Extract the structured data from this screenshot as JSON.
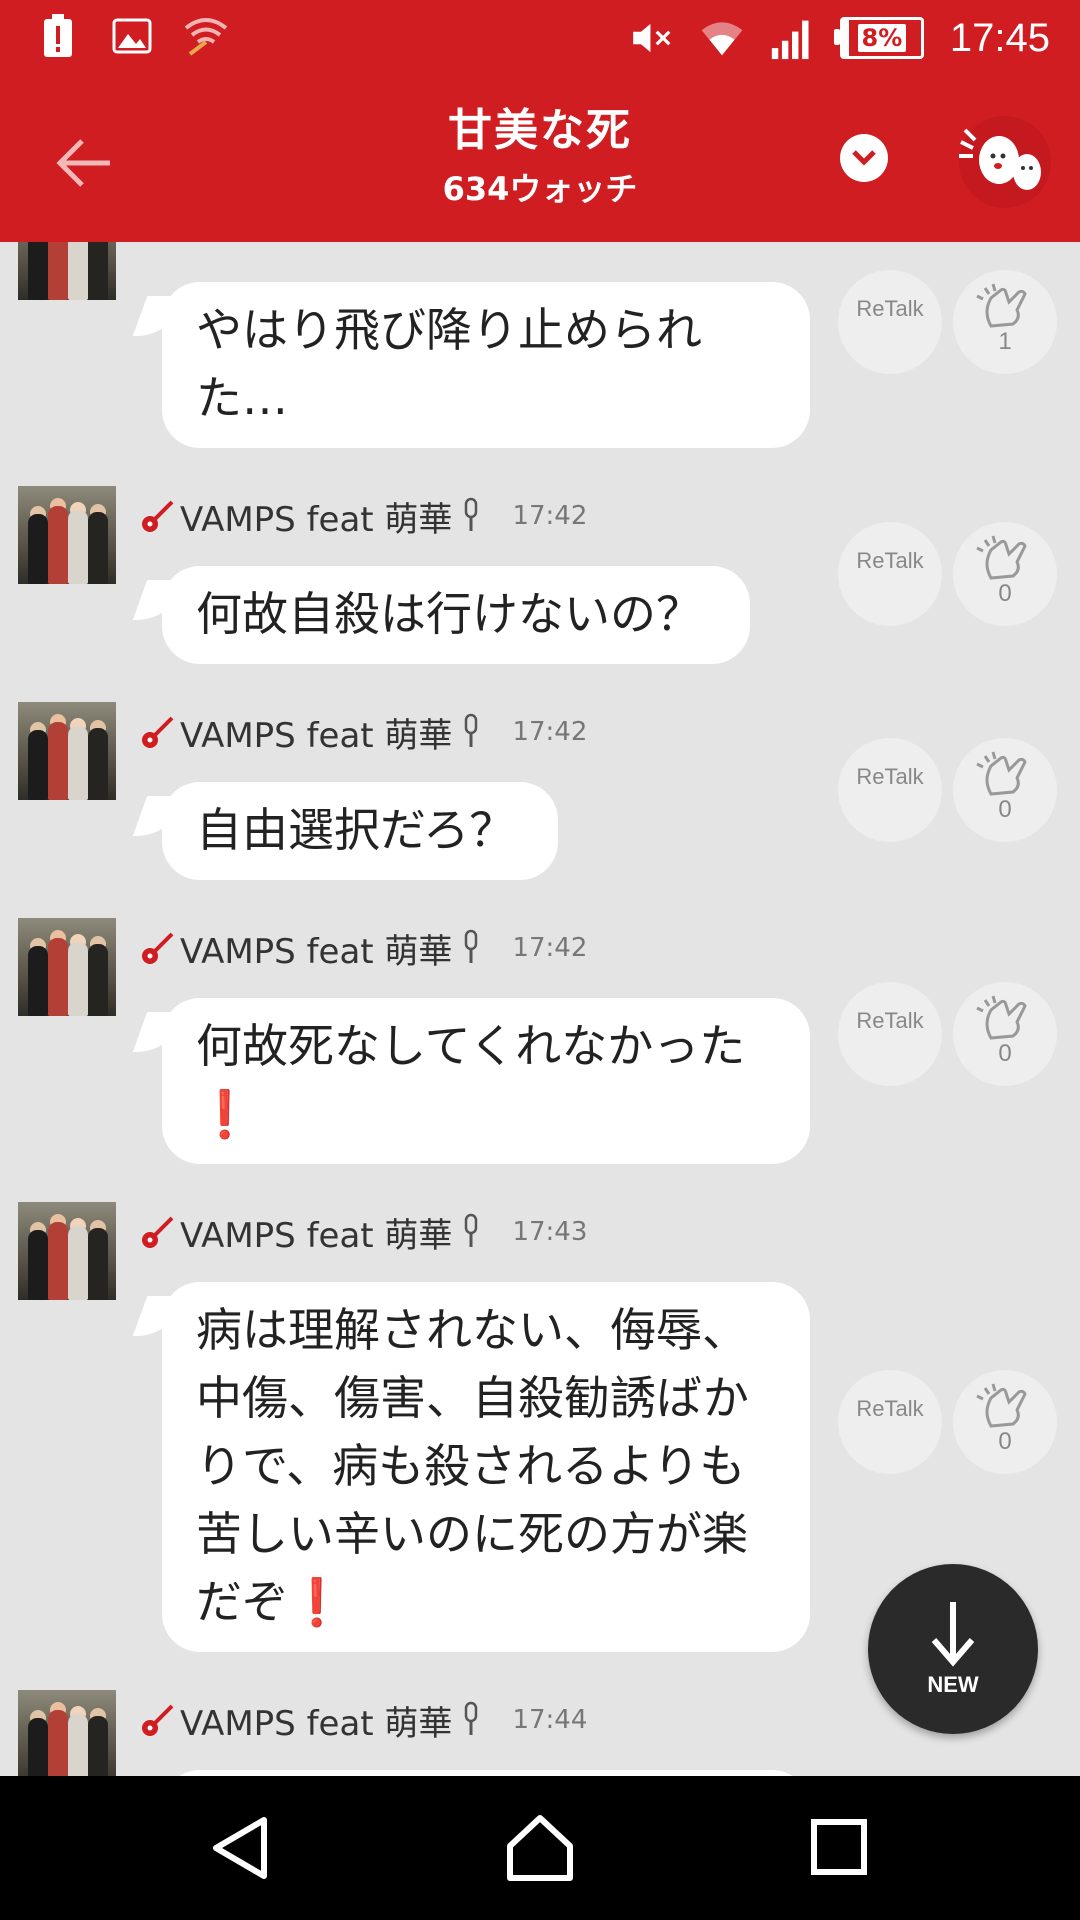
{
  "status_bar": {
    "time": "17:45",
    "battery": "8%",
    "battery_level": 0.08,
    "icons": [
      "battery-alert-icon",
      "image-notification-icon",
      "wifi-off-icon",
      "mute-icon",
      "wifi-icon",
      "signal-icon"
    ]
  },
  "app_bar": {
    "title": "甘美な死",
    "subtitle": "634ウォッチ",
    "icons": [
      "back-arrow-icon",
      "chevron-down-icon",
      "clapping-mascot-icon"
    ]
  },
  "messages": [
    {
      "user": "",
      "time": "",
      "text": "やはり飛び降り止められた…",
      "lines": [
        "やはり飛び降り止められ",
        "た…"
      ],
      "retalk": "ReTalk",
      "claps": "1"
    },
    {
      "user": "VAMPS feat 萌華",
      "time": "17:42",
      "lines": [
        "何故自殺は行けないの？"
      ],
      "retalk": "ReTalk",
      "claps": "0"
    },
    {
      "user": "VAMPS feat 萌華",
      "time": "17:42",
      "lines": [
        "自由選択だろ？"
      ],
      "retalk": "ReTalk",
      "claps": "0"
    },
    {
      "user": "VAMPS feat 萌華",
      "time": "17:42",
      "lines": [
        "何故死なしてくれなかった"
      ],
      "exclaim": "❗",
      "retalk": "ReTalk",
      "claps": "0"
    },
    {
      "user": "VAMPS feat 萌華",
      "time": "17:43",
      "lines": [
        "病は理解されない、侮辱、",
        "中傷、傷害、自殺勧誘ばか",
        "りで、病も殺されるよりも",
        "苦しい辛いのに死の方が楽",
        "だぞ"
      ],
      "exclaim": "❗",
      "retalk": "ReTalk",
      "claps": "0"
    },
    {
      "user": "VAMPS feat 萌華",
      "time": "17:44"
    }
  ],
  "new_button": {
    "label": "NEW"
  },
  "nav_bar": {
    "icons": [
      "back-triangle-icon",
      "home-icon",
      "recents-icon"
    ]
  },
  "colors": {
    "accent": "#d01d22",
    "background": "#e4e4e4",
    "bubble": "#ffffff",
    "fab": "#2a2a2a"
  }
}
